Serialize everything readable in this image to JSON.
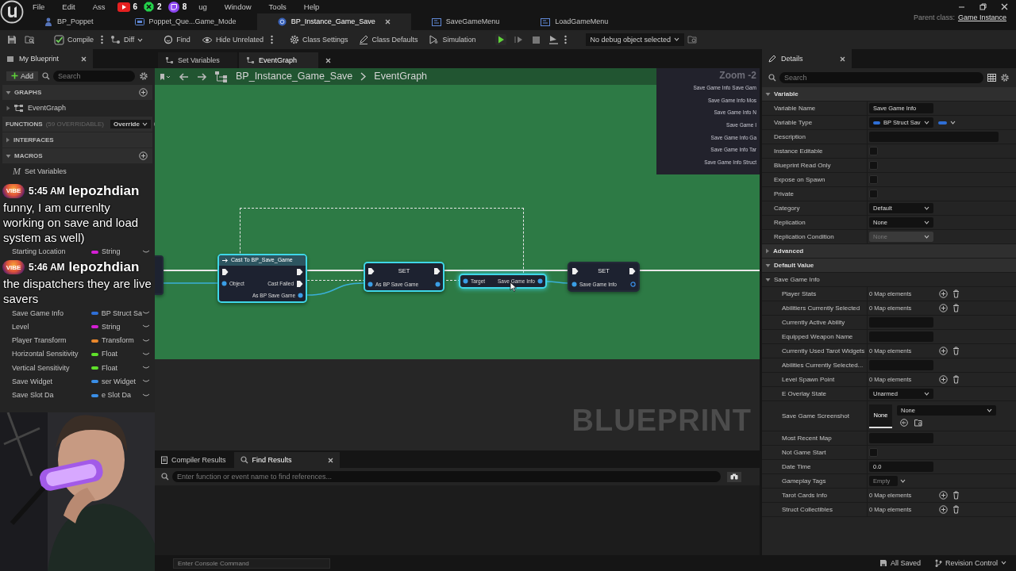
{
  "menu_bar": {
    "items": [
      "File",
      "Edit",
      "Ass",
      "ug",
      "Window",
      "Tools",
      "Help"
    ]
  },
  "stream_counters": [
    {
      "kind": "youtube",
      "count": "6"
    },
    {
      "kind": "xbox",
      "count": "2"
    },
    {
      "kind": "twitch",
      "count": "8"
    }
  ],
  "asset_tabs": [
    {
      "label": "BP_Poppet",
      "kind": "actor",
      "selected": false
    },
    {
      "label": "Poppet_Que...Game_Mode",
      "kind": "gamemode",
      "selected": false
    },
    {
      "label": "BP_Instance_Game_Save",
      "kind": "instance",
      "selected": true
    },
    {
      "label": "SaveGameMenu",
      "kind": "widget",
      "selected": false
    },
    {
      "label": "LoadGameMenu",
      "kind": "widget",
      "selected": false
    }
  ],
  "parent_class": {
    "label": "Parent class:",
    "value": "Game Instance"
  },
  "toolbar": {
    "buttons": [
      {
        "kind": "save"
      },
      {
        "kind": "browse"
      },
      {
        "kind": "compile",
        "label": "Compile",
        "menu": true
      },
      {
        "kind": "diff",
        "label": "Diff"
      },
      {
        "kind": "find",
        "label": "Find"
      },
      {
        "kind": "hide",
        "label": "Hide Unrelated",
        "menu": true
      },
      {
        "kind": "settings",
        "label": "Class Settings"
      },
      {
        "kind": "defaults",
        "label": "Class Defaults"
      },
      {
        "kind": "simulation",
        "label": "Simulation"
      },
      {
        "kind": "play"
      },
      {
        "kind": "step"
      },
      {
        "kind": "stop"
      },
      {
        "kind": "eject",
        "menu": true
      }
    ],
    "debug_select": "No debug object selected"
  },
  "my_blueprint": {
    "title": "My Blueprint",
    "add_label": "Add",
    "search_placeholder": "Search",
    "sections": [
      {
        "kind": "header",
        "label": "GRAPHS",
        "expanded": true,
        "addable": true
      },
      {
        "kind": "item",
        "label": "EventGraph"
      },
      {
        "kind": "header",
        "label": "FUNCTIONS",
        "note": "(59 OVERRIDABLE)",
        "dropdown": "Override",
        "addable": true
      },
      {
        "kind": "header",
        "label": "INTERFACES",
        "expanded": false,
        "addable": false
      },
      {
        "kind": "header",
        "label": "MACROS",
        "expanded": true,
        "addable": true
      },
      {
        "kind": "macro",
        "badge": "M",
        "label": "Set Variables"
      }
    ],
    "variables_area": [
      {
        "kind": "chat",
        "badge": "VIBE",
        "time": "5:45 AM",
        "user": "lepozhdian",
        "text": "funny, I am currenlty working on save and load system as well)"
      },
      {
        "kind": "variable",
        "name": "Starting Location",
        "type": "String",
        "color": "#d41fd4"
      },
      {
        "kind": "chat",
        "badge": "VIBE",
        "time": "5:46 AM",
        "user": "lepozhdian",
        "text": "the dispatchers they are live savers"
      },
      {
        "kind": "variable",
        "name": "Save Game Info",
        "type": "BP Struct Sa",
        "color": "#2f6fd6"
      },
      {
        "kind": "variable",
        "name": "Level",
        "type": "String",
        "color": "#d41fd4"
      },
      {
        "kind": "variable",
        "name": "Player Transform",
        "type": "Transform",
        "color": "#e8872c"
      },
      {
        "kind": "variable",
        "name": "Horizontal Sensitivity",
        "type": "Float",
        "color": "#5fe02a"
      },
      {
        "kind": "variable",
        "name": "Vertical Sensitivity",
        "type": "Float",
        "color": "#5fe02a"
      },
      {
        "kind": "variable",
        "name": "Save Widget",
        "type": "ser Widget",
        "color": "#3a8ee6"
      },
      {
        "kind": "variable",
        "name": "Save Slot Da",
        "type": "e Slot Da",
        "color": "#3a8ee6"
      }
    ]
  },
  "graph": {
    "tabs": [
      {
        "label": "Set Variables",
        "selected": false
      },
      {
        "label": "EventGraph",
        "selected": true
      }
    ],
    "breadcrumb": [
      "BP_Instance_Game_Save",
      "EventGraph"
    ],
    "zoom_label": "Zoom -2",
    "suggestions": [
      "Save Game Info Save Gam",
      "Save Game Info Mos",
      "Save Game Info N",
      "Save Game I",
      "Save Game Info Ga",
      "Save Game Info Tar",
      "Save Game Info Struct"
    ],
    "nodes": [
      {
        "kind": "stub",
        "selected": false
      },
      {
        "kind": "cast",
        "title": "Cast To BP_Save_Game",
        "selected": true,
        "inputs": [
          {
            "label": "Object",
            "kind": "data"
          }
        ],
        "outputs": [
          {
            "label": "Cast Failed",
            "kind": "exec"
          },
          {
            "label": "As BP Save Game",
            "kind": "data"
          }
        ]
      },
      {
        "kind": "set",
        "title": "SET",
        "selected": true,
        "inputs": [
          {
            "label": "As BP Save Game",
            "kind": "data"
          }
        ],
        "outputs": [
          {
            "kind": "data"
          }
        ]
      },
      {
        "kind": "getter",
        "selected": true,
        "inputs": [
          {
            "label": "Target",
            "kind": "data"
          }
        ],
        "outputs": [
          {
            "label": "Save Game Info",
            "kind": "data"
          }
        ]
      },
      {
        "kind": "set",
        "title": "SET",
        "selected": false,
        "inputs": [
          {
            "label": "Save Game Info",
            "kind": "data"
          }
        ],
        "outputs": [
          {
            "kind": "hollow"
          }
        ]
      }
    ],
    "watermark": "BLUEPRINT"
  },
  "bottom_panel": {
    "tabs": [
      {
        "label": "Compiler Results",
        "selected": false
      },
      {
        "label": "Find Results",
        "selected": true
      }
    ],
    "search_placeholder": "Enter function or event name to find references..."
  },
  "details": {
    "title": "Details",
    "search_placeholder": "Search",
    "sections": [
      {
        "label": "Variable",
        "expanded": true,
        "rows": [
          {
            "label": "Variable Name",
            "kind": "text",
            "value": "Save Game Info"
          },
          {
            "label": "Variable Type",
            "kind": "type",
            "value": "BP Struct Sav",
            "color": "#2f6fd6"
          },
          {
            "label": "Description",
            "kind": "wide"
          },
          {
            "label": "Instance Editable",
            "kind": "checkbox",
            "checked": false
          },
          {
            "label": "Blueprint Read Only",
            "kind": "checkbox",
            "checked": false
          },
          {
            "label": "Expose on Spawn",
            "kind": "checkbox",
            "checked": false
          },
          {
            "label": "Private",
            "kind": "checkbox",
            "checked": false
          },
          {
            "label": "Category",
            "kind": "dropdown",
            "value": "Default",
            "disabled": false
          },
          {
            "label": "Replication",
            "kind": "dropdown",
            "value": "None",
            "disabled": false
          },
          {
            "label": "Replication Condition",
            "kind": "dropdown",
            "value": "None",
            "disabled": true
          }
        ]
      },
      {
        "label": "Advanced",
        "expanded": false
      },
      {
        "label": "Default Value",
        "expanded": true,
        "groups": [
          {
            "label": "Save Game Info",
            "expanded": true,
            "rows": [
              {
                "label": "Player Stats",
                "kind": "map",
                "value": "0 Map elements"
              },
              {
                "label": "Abilitiers Currently Selected",
                "kind": "map",
                "value": "0 Map elements"
              },
              {
                "label": "Currently Active Ability",
                "kind": "text"
              },
              {
                "label": "Equipped Weapon Name",
                "kind": "text"
              },
              {
                "label": "Currently Used Tarot Widgets",
                "kind": "map",
                "value": "0 Map elements"
              },
              {
                "label": "Abilities Currently Selected...",
                "kind": "text"
              },
              {
                "label": "Level Spawn Point",
                "kind": "map",
                "value": "0 Map elements"
              },
              {
                "label": "E Overlay State",
                "kind": "dropdown",
                "value": "Unarmed",
                "disabled": false
              },
              {
                "label": "Save Game Screenshot",
                "kind": "texture",
                "thumb": "None",
                "value": "None"
              },
              {
                "label": "Most Recent Map",
                "kind": "text"
              },
              {
                "label": "Not Game Start",
                "kind": "checkbox",
                "checked": false
              },
              {
                "label": "Date Time",
                "kind": "text",
                "value": "0.0"
              },
              {
                "label": "Gameplay Tags",
                "kind": "tags",
                "value": "Empty"
              },
              {
                "label": "Tarot Cards Info",
                "kind": "map",
                "value": "0 Map elements"
              },
              {
                "label": "Struct Collectibles",
                "kind": "map",
                "value": "0 Map elements"
              }
            ]
          }
        ]
      }
    ]
  },
  "status_bar": {
    "console_placeholder": "Enter Console Command",
    "save_state": "All Saved",
    "revision_control": "Revision Control"
  }
}
